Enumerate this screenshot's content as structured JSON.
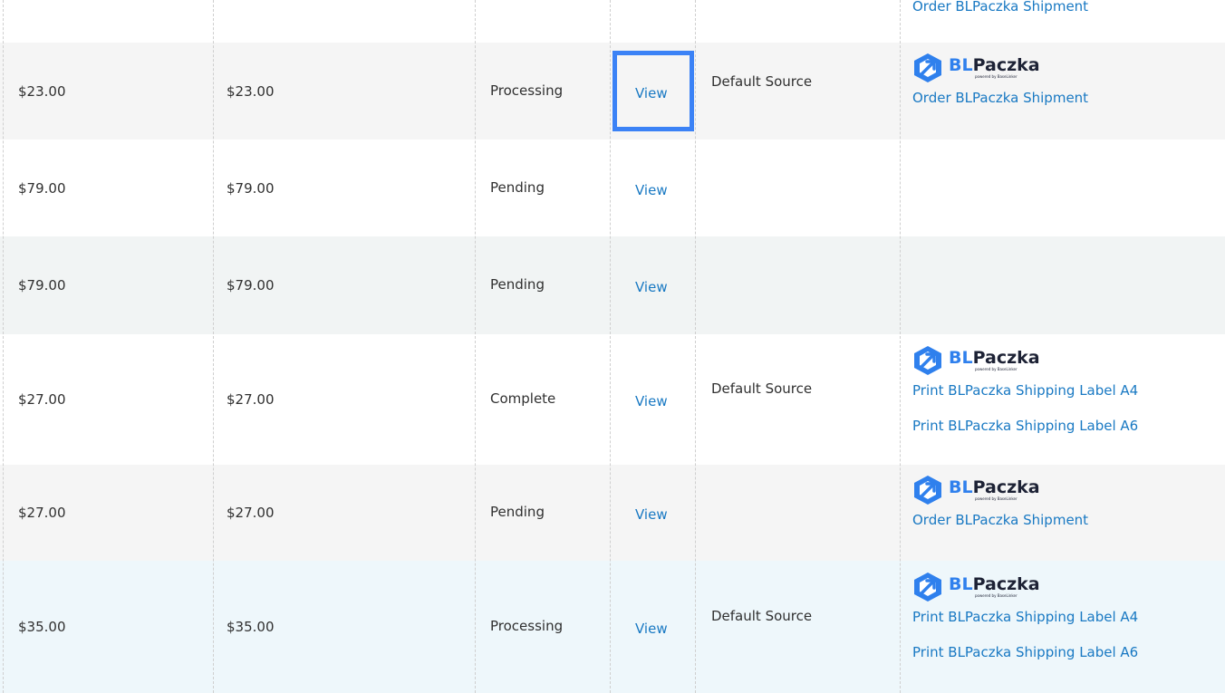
{
  "brand": {
    "bl": "BL",
    "paczka": "Paczka",
    "powered": "powered by BaseLinker"
  },
  "colors": {
    "link": "#1979c3",
    "highlight": "#3b82f6",
    "logo_blue": "#2f80ed"
  },
  "rows": [
    {
      "purchase": "",
      "grand_total": "",
      "status": "",
      "action": "",
      "source": "",
      "logo": false,
      "links": [
        "Order BLPaczka Shipment"
      ]
    },
    {
      "purchase": "$23.00",
      "grand_total": "$23.00",
      "status": "Processing",
      "action": "View",
      "source": "Default Source",
      "logo": true,
      "links": [
        "Order BLPaczka Shipment"
      ],
      "highlighted": true
    },
    {
      "purchase": "$79.00",
      "grand_total": "$79.00",
      "status": "Pending",
      "action": "View",
      "source": "",
      "logo": false,
      "links": []
    },
    {
      "purchase": "$79.00",
      "grand_total": "$79.00",
      "status": "Pending",
      "action": "View",
      "source": "",
      "logo": false,
      "links": []
    },
    {
      "purchase": "$27.00",
      "grand_total": "$27.00",
      "status": "Complete",
      "action": "View",
      "source": "Default Source",
      "logo": true,
      "links": [
        "Print BLPaczka Shipping Label A4",
        "Print BLPaczka Shipping Label A6"
      ]
    },
    {
      "purchase": "$27.00",
      "grand_total": "$27.00",
      "status": "Pending",
      "action": "View",
      "source": "",
      "logo": true,
      "links": [
        "Order BLPaczka Shipment"
      ]
    },
    {
      "purchase": "$35.00",
      "grand_total": "$35.00",
      "status": "Processing",
      "action": "View",
      "source": "Default Source",
      "logo": true,
      "links": [
        "Print BLPaczka Shipping Label A4",
        "Print BLPaczka Shipping Label A6"
      ]
    }
  ]
}
